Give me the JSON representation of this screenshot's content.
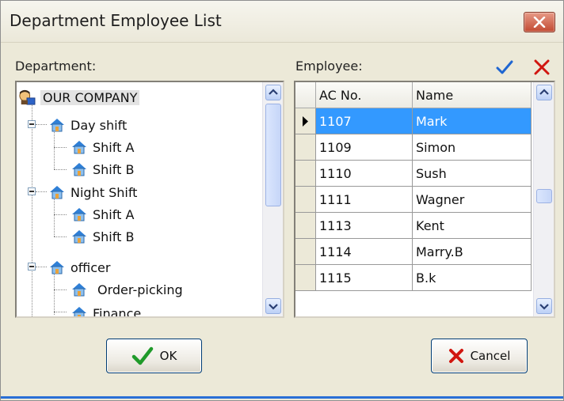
{
  "window": {
    "title": "Department Employee List",
    "close_icon": "close-icon"
  },
  "department_panel": {
    "label": "Department:",
    "tree": [
      {
        "label": "OUR COMPANY",
        "level": 0,
        "icon": "company-icon"
      },
      {
        "label": "Day shift",
        "level": 1,
        "icon": "house-icon",
        "expanded": true
      },
      {
        "label": "Shift A",
        "level": 2,
        "icon": "house-icon"
      },
      {
        "label": "Shift B",
        "level": 2,
        "icon": "house-icon"
      },
      {
        "label": "Night Shift",
        "level": 1,
        "icon": "house-icon",
        "expanded": true
      },
      {
        "label": "Shift A",
        "level": 2,
        "icon": "house-icon"
      },
      {
        "label": "Shift B",
        "level": 2,
        "icon": "house-icon"
      },
      {
        "label": "officer",
        "level": 1,
        "icon": "house-icon",
        "expanded": true
      },
      {
        "label": "Order-picking",
        "level": 2,
        "icon": "house-icon"
      },
      {
        "label": "Finance",
        "level": 2,
        "icon": "house-icon"
      }
    ]
  },
  "employee_panel": {
    "label": "Employee:",
    "confirm_icon": "checkmark-icon",
    "clear_icon": "red-x-icon",
    "columns": [
      "AC No.",
      "Name"
    ],
    "rows": [
      {
        "ac_no": "1107",
        "name": "Mark",
        "selected": true
      },
      {
        "ac_no": "1109",
        "name": "Simon"
      },
      {
        "ac_no": "1110",
        "name": "Sush"
      },
      {
        "ac_no": "1111",
        "name": "Wagner"
      },
      {
        "ac_no": "1113",
        "name": "Kent"
      },
      {
        "ac_no": "1114",
        "name": "Marry.B"
      },
      {
        "ac_no": "1115",
        "name": "B.k"
      }
    ]
  },
  "buttons": {
    "ok": "OK",
    "cancel": "Cancel"
  },
  "colors": {
    "selection": "#3399ff",
    "check": "#1f66d1",
    "cancel_x": "#d1160f"
  }
}
